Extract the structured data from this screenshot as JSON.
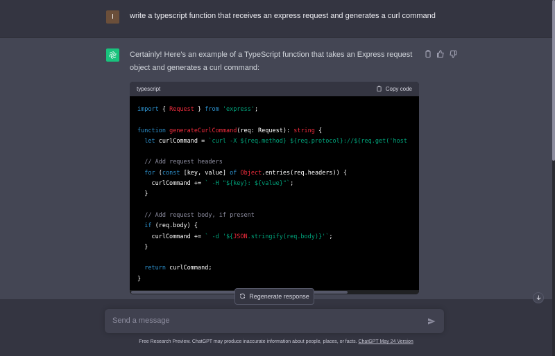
{
  "user_message": {
    "avatar_letter": "I",
    "text": "write a typescript function that receives an express request and generates a curl command"
  },
  "assistant_message": {
    "avatar_icon": "openai-logo-icon",
    "intro": "Certainly! Here's an example of a TypeScript function that takes an Express request object and generates a curl command:",
    "actions": [
      "copy-icon",
      "thumbs-up-icon",
      "thumbs-down-icon"
    ]
  },
  "code_block": {
    "language": "typescript",
    "copy_label": "Copy code",
    "lines": [
      "import { Request } from 'express';",
      "",
      "function generateCurlCommand(req: Request): string {",
      "  let curlCommand = `curl -X ${req.method} ${req.protocol}://${req.get('host",
      "",
      "  // Add request headers",
      "  for (const [key, value] of Object.entries(req.headers)) {",
      "    curlCommand += ` -H \"${key}: ${value}\"`;",
      "  }",
      "",
      "  // Add request body, if present",
      "  if (req.body) {",
      "    curlCommand += ` -d '${JSON.stringify(req.body)}'`;",
      "  }",
      "",
      "  return curlCommand;",
      "}"
    ]
  },
  "regenerate_label": "Regenerate response",
  "composer": {
    "placeholder": "Send a message"
  },
  "footer": {
    "text": "Free Research Preview. ChatGPT may produce inaccurate information about people, places, or facts.",
    "link": "ChatGPT May 24 Version"
  },
  "colors": {
    "accent_green": "#19c37d",
    "background": "#444654",
    "user_row": "#343541"
  }
}
